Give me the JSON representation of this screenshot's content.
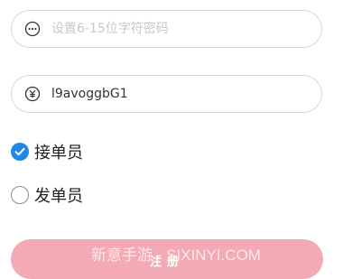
{
  "password_field": {
    "icon": "more-dots-icon",
    "value": "",
    "placeholder": "设置6-15位字符密码"
  },
  "invite_field": {
    "icon": "yuan-circle-icon",
    "value": "l9avoggbG1",
    "placeholder": ""
  },
  "role_options": [
    {
      "label": "接单员",
      "checked": true
    },
    {
      "label": "发单员",
      "checked": false
    }
  ],
  "register_button": {
    "label": "注册"
  },
  "watermark": {
    "text": "新意手游 - SIXINYI.COM"
  },
  "colors": {
    "accent": "#1e88e5",
    "button": "#f4aab4",
    "border": "#d9d9d9"
  }
}
